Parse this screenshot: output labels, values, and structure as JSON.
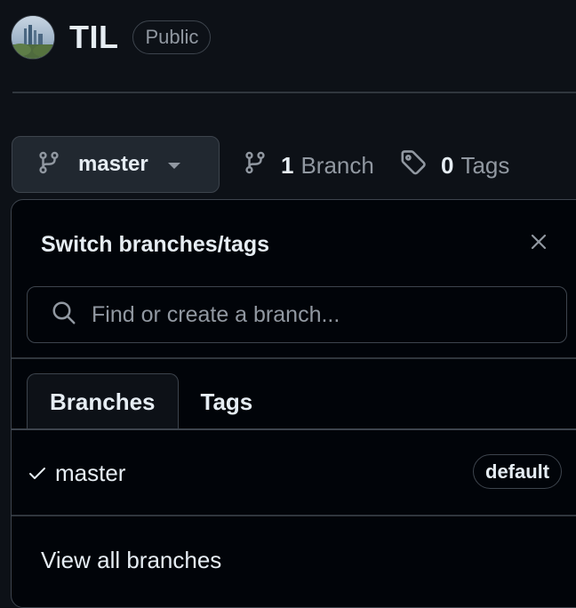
{
  "repo": {
    "name": "TIL",
    "visibility": "Public"
  },
  "branch_selector": {
    "current_branch": "master"
  },
  "stats": {
    "branch_count": "1",
    "branch_label": "Branch",
    "tag_count": "0",
    "tag_label": "Tags"
  },
  "dropdown": {
    "title": "Switch branches/tags",
    "search_placeholder": "Find or create a branch...",
    "tabs": [
      {
        "label": "Branches",
        "active": true
      },
      {
        "label": "Tags",
        "active": false
      }
    ],
    "branches": [
      {
        "name": "master",
        "selected": true,
        "badge": "default"
      }
    ],
    "footer_link": "View all branches"
  },
  "icons": {
    "branch": "git-branch-icon",
    "tag": "tag-icon",
    "search": "search-icon",
    "close": "close-icon",
    "check": "check-icon",
    "caret": "triangle-down-icon"
  },
  "colors": {
    "page_bg": "#0d1117",
    "overlay_bg": "#010409",
    "button_bg": "#212830",
    "border": "#3d444d",
    "text_primary": "#e6edf3",
    "text_muted": "#9198a1"
  }
}
